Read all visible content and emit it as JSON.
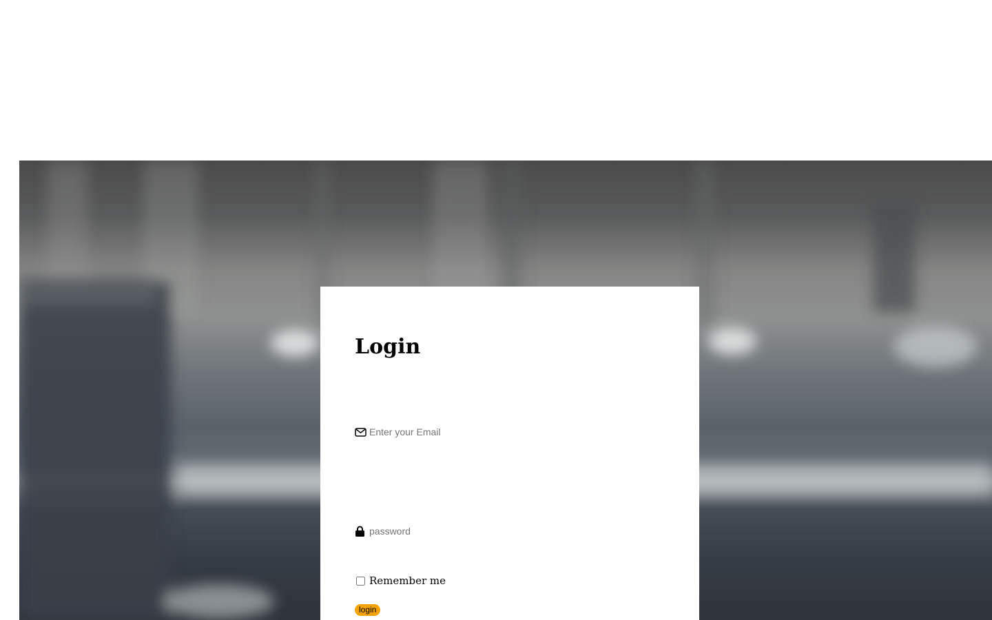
{
  "login": {
    "title": "Login",
    "email_placeholder": "Enter your Email",
    "password_placeholder": "password",
    "remember_label": "Remember me",
    "submit_label": "login",
    "accent_color": "#f5a300"
  },
  "icons": {
    "email": "envelope-icon",
    "password": "lock-icon"
  }
}
